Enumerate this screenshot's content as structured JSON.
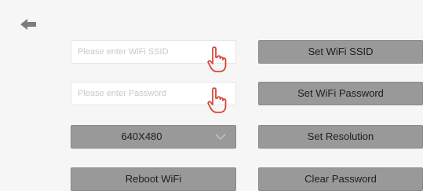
{
  "inputs": {
    "ssid": {
      "placeholder": "Please enter WiFi SSID",
      "value": ""
    },
    "password": {
      "placeholder": "Please enter Password",
      "value": ""
    }
  },
  "buttons": {
    "set_ssid": "Set WiFi SSID",
    "set_password": "Set WiFi Password",
    "set_resolution": "Set Resolution",
    "reboot_wifi": "Reboot WiFi",
    "clear_password": "Clear Password"
  },
  "resolution_select": {
    "selected": "640X480"
  },
  "icons": {
    "back": "back-arrow-icon",
    "pointer": "pointing-hand-icon",
    "dropdown": "chevron-down-icon"
  },
  "colors": {
    "background": "#f6f6f6",
    "button": "#999999",
    "accent": "#d8453a"
  }
}
